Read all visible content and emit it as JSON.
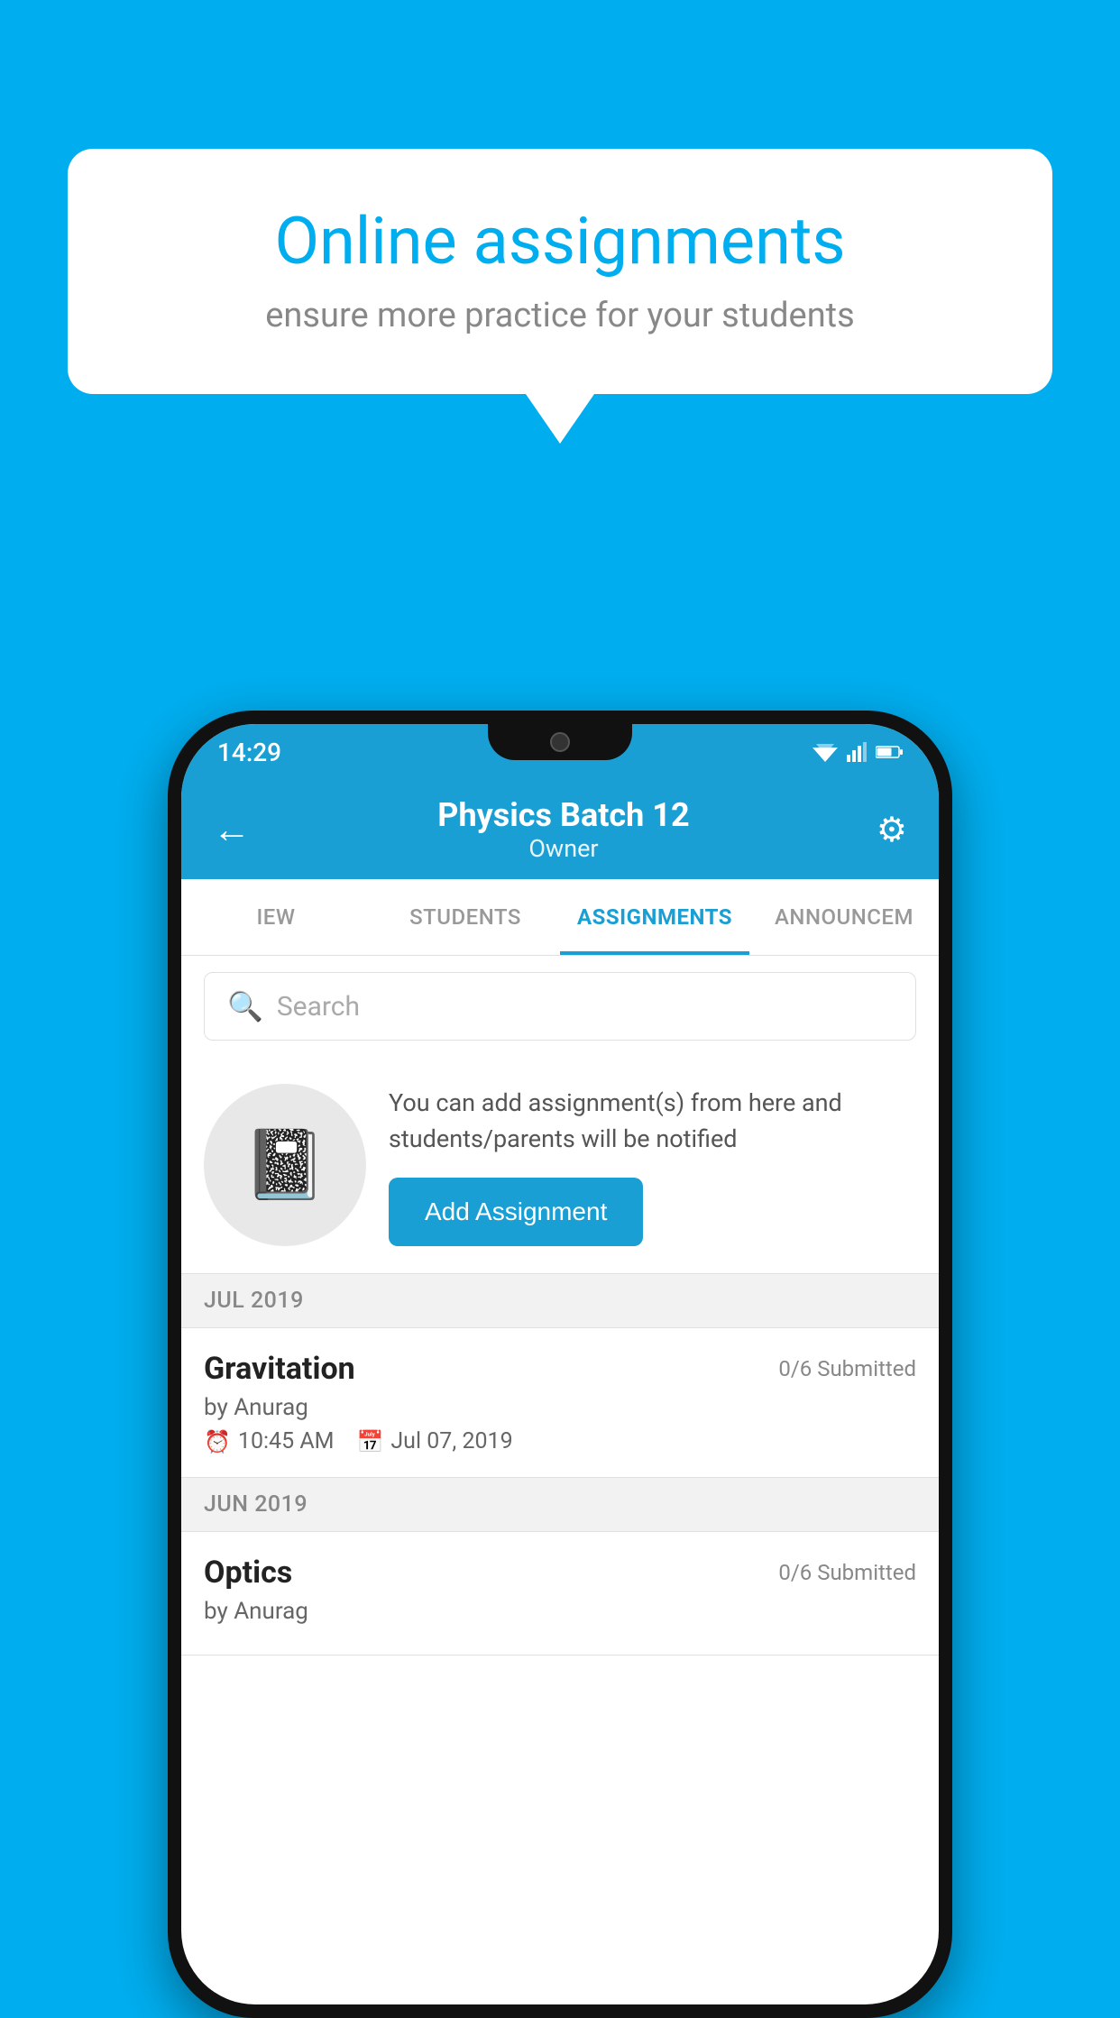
{
  "background_color": "#00AEEF",
  "speech_bubble": {
    "title": "Online assignments",
    "subtitle": "ensure more practice for your students"
  },
  "status_bar": {
    "time": "14:29"
  },
  "app_bar": {
    "title": "Physics Batch 12",
    "subtitle": "Owner",
    "back_label": "←",
    "settings_label": "⚙"
  },
  "tabs": [
    {
      "label": "IEW",
      "active": false
    },
    {
      "label": "STUDENTS",
      "active": false
    },
    {
      "label": "ASSIGNMENTS",
      "active": true
    },
    {
      "label": "ANNOUNCEM",
      "active": false
    }
  ],
  "search": {
    "placeholder": "Search"
  },
  "info_card": {
    "text": "You can add assignment(s) from here and students/parents will be notified",
    "button_label": "Add Assignment"
  },
  "sections": [
    {
      "month": "JUL 2019",
      "assignments": [
        {
          "title": "Gravitation",
          "submitted": "0/6 Submitted",
          "author": "by Anurag",
          "time": "10:45 AM",
          "date": "Jul 07, 2019"
        }
      ]
    },
    {
      "month": "JUN 2019",
      "assignments": [
        {
          "title": "Optics",
          "submitted": "0/6 Submitted",
          "author": "by Anurag",
          "time": "",
          "date": ""
        }
      ]
    }
  ]
}
